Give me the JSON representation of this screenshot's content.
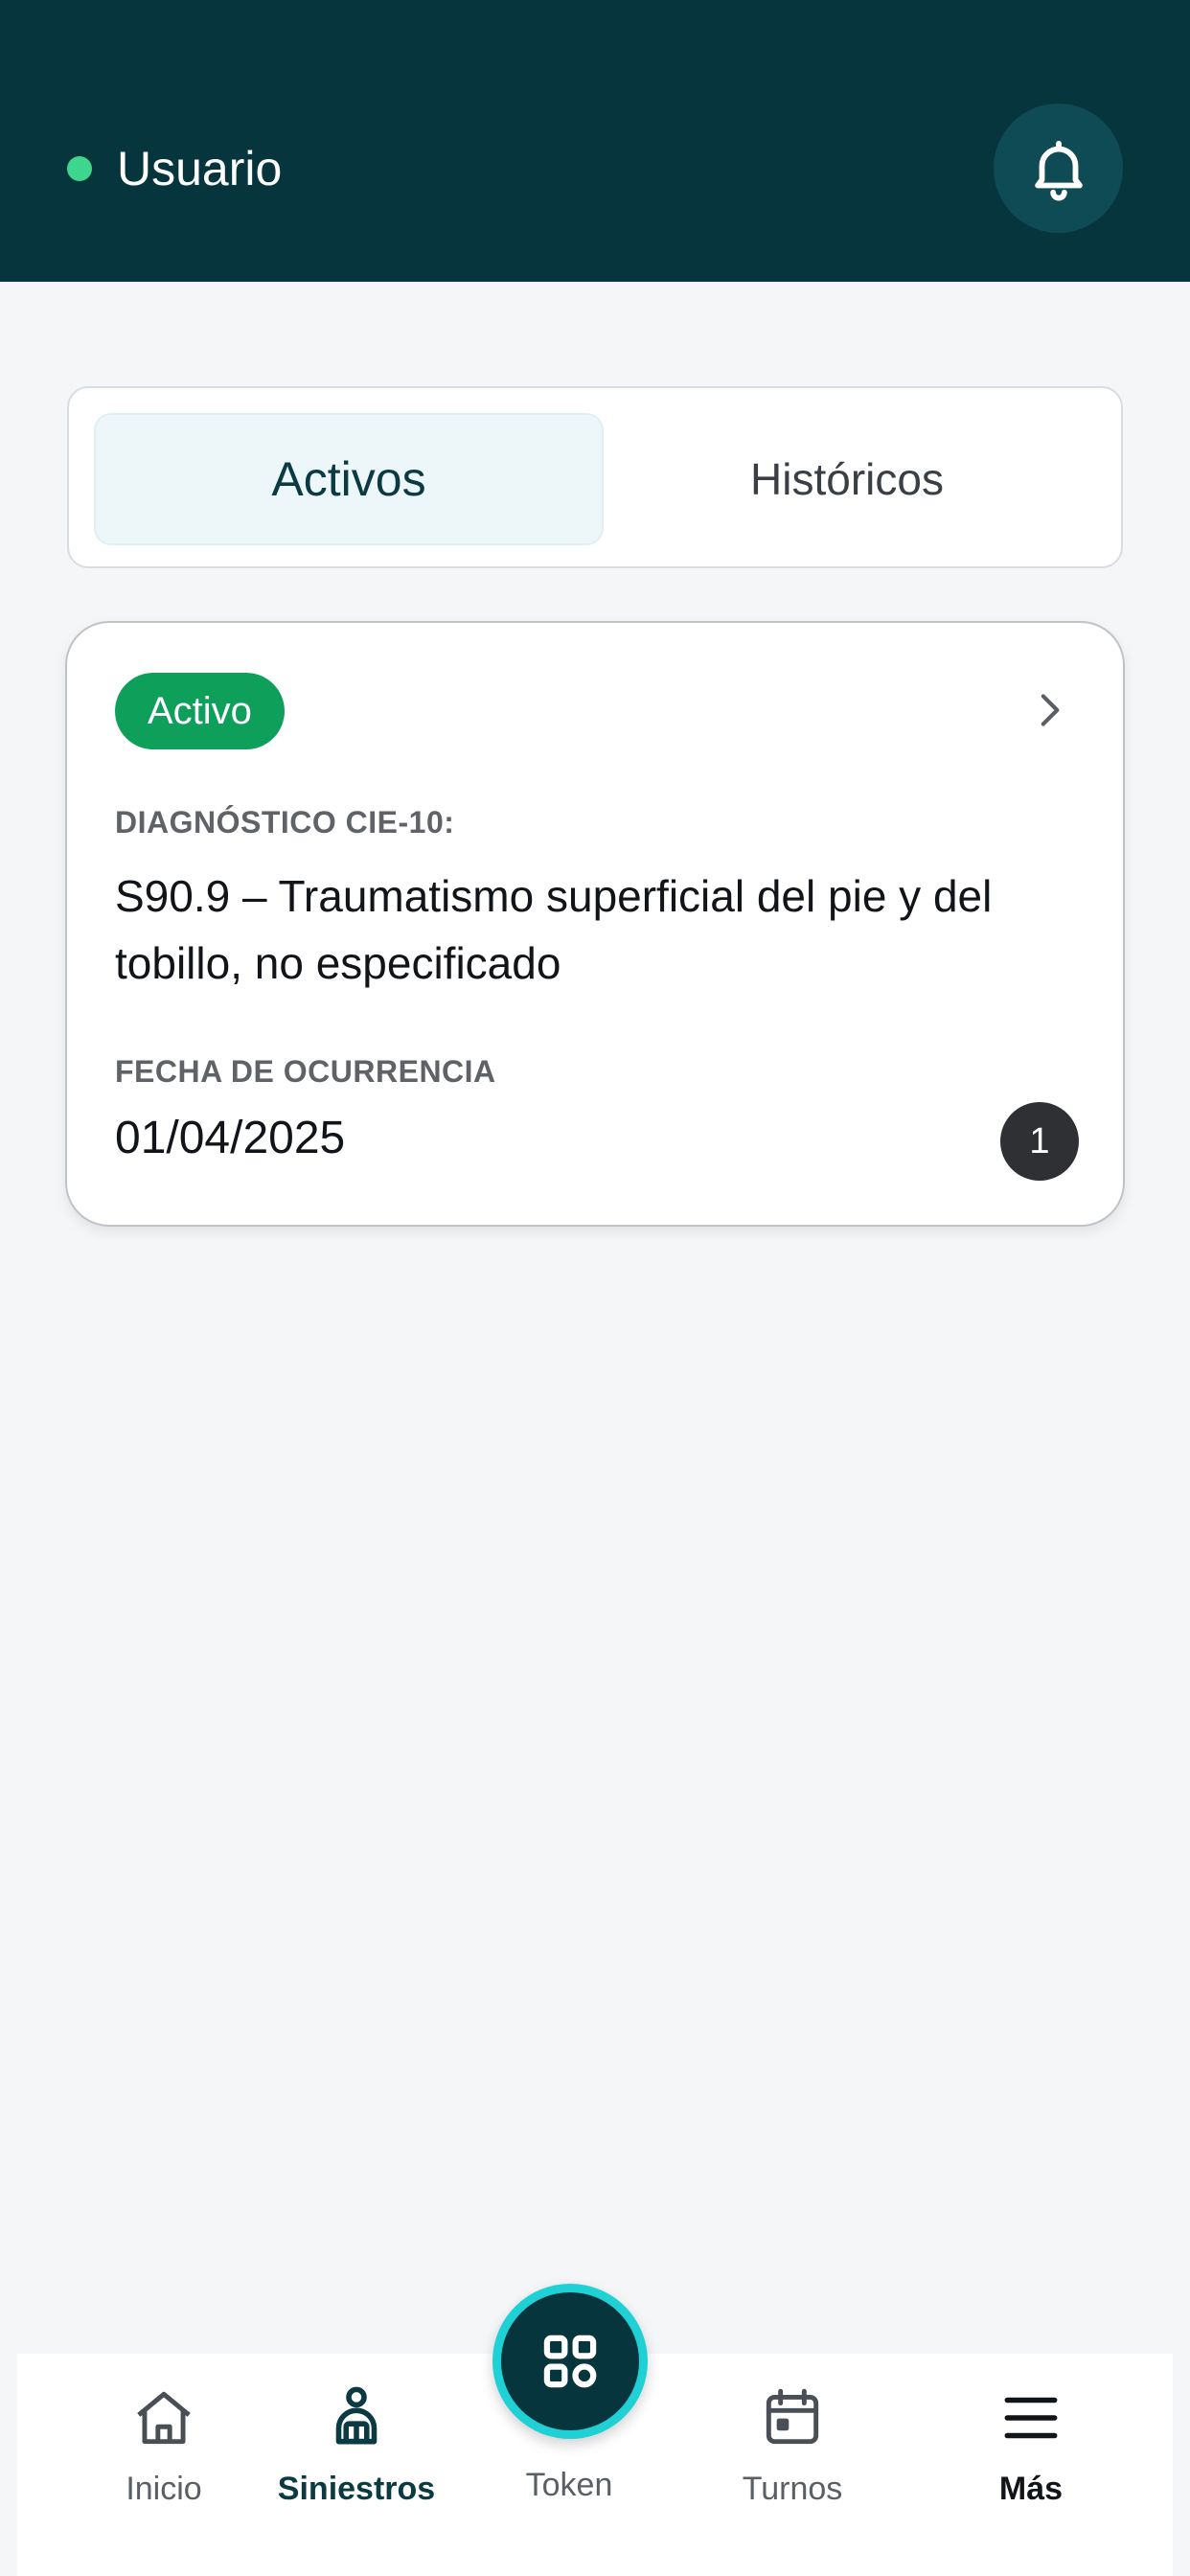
{
  "header": {
    "user_name": "Usuario",
    "status_color": "#3DD68C",
    "notification_icon": "bell-icon"
  },
  "tabs": [
    {
      "label": "Activos",
      "selected": true
    },
    {
      "label": "Históricos",
      "selected": false
    }
  ],
  "claim": {
    "status": "Activo",
    "diagnosis_label": "DIAGNÓSTICO CIE-10:",
    "diagnosis": "S90.9 – Traumatismo superficial del  pie y del tobillo, no especificado",
    "date_label": "FECHA DE OCURRENCIA",
    "date": "01/04/2025",
    "count": "1"
  },
  "nav": {
    "items": [
      {
        "label": "Inicio",
        "icon": "home-icon"
      },
      {
        "label": "Siniestros",
        "icon": "person-injury-icon",
        "active": true
      },
      {
        "label": "Token",
        "icon": "grid-icon"
      },
      {
        "label": "Turnos",
        "icon": "calendar-icon"
      },
      {
        "label": "Más",
        "icon": "menu-icon"
      }
    ]
  },
  "colors": {
    "header_bg": "#06353D",
    "badge_active": "#0E9F5A",
    "fab_ring": "#1FD1D4"
  }
}
